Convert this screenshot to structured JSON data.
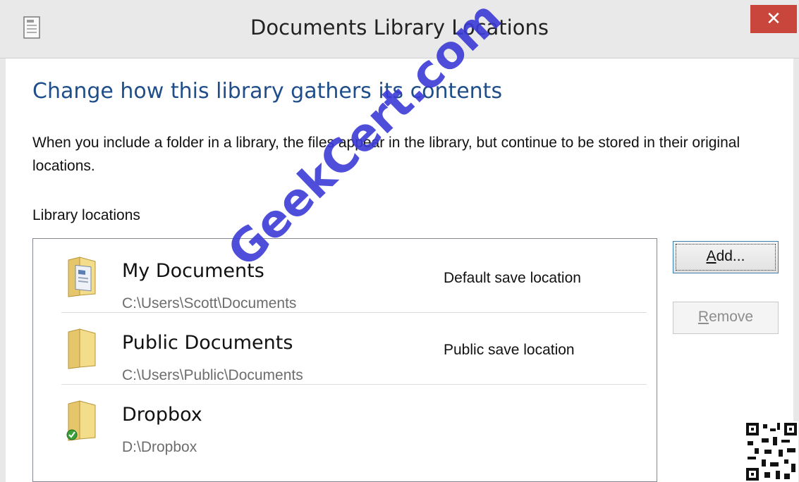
{
  "window": {
    "title": "Documents Library Locations",
    "close_label": "✕"
  },
  "heading": "Change how this library gathers its contents",
  "description": "When you include a folder in a library, the files appear in the library, but continue to be stored in their original locations.",
  "locations_label": "Library locations",
  "locations": [
    {
      "name": "My Documents",
      "path": "C:\\Users\\Scott\\Documents",
      "status": "Default save location",
      "icon": "documents-folder-icon"
    },
    {
      "name": "Public Documents",
      "path": "C:\\Users\\Public\\Documents",
      "status": "Public save location",
      "icon": "folder-icon"
    },
    {
      "name": "Dropbox",
      "path": "D:\\Dropbox",
      "status": "",
      "icon": "dropbox-folder-icon"
    }
  ],
  "buttons": {
    "add": {
      "access_key": "A",
      "rest": "dd..."
    },
    "remove": {
      "access_key": "R",
      "rest": "emove"
    }
  },
  "watermark": "GeekCert.com",
  "colors": {
    "heading": "#1f4e8a",
    "close": "#c9463d",
    "watermark": "#3b3bd6"
  }
}
